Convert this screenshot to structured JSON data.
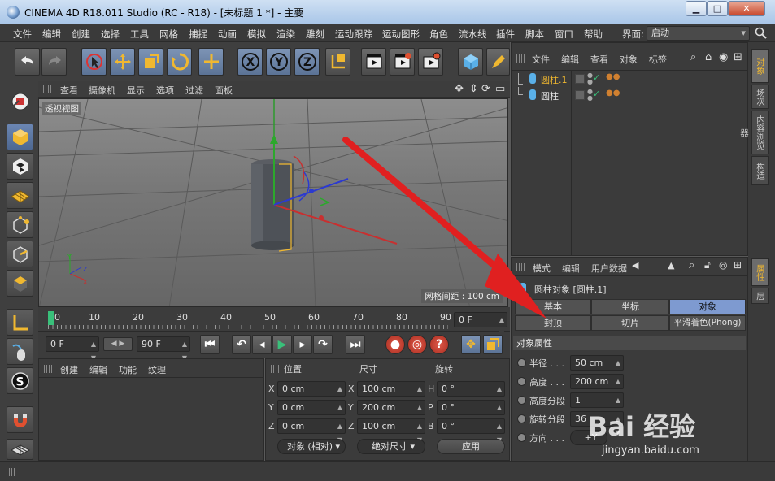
{
  "window": {
    "title": "CINEMA 4D R18.011 Studio (RC - R18) - [未标题 1 *] - 主要",
    "min": "▁",
    "max": "□",
    "close": "✕"
  },
  "menu": [
    "文件",
    "编辑",
    "创建",
    "选择",
    "工具",
    "网格",
    "捕捉",
    "动画",
    "模拟",
    "渲染",
    "雕刻",
    "运动跟踪",
    "运动图形",
    "角色",
    "流水线",
    "插件",
    "脚本",
    "窗口",
    "帮助"
  ],
  "layout": {
    "label": "界面:",
    "value": "启动"
  },
  "viewport": {
    "menu": [
      "查看",
      "摄像机",
      "显示",
      "选项",
      "过滤",
      "面板"
    ],
    "label": "透视视图",
    "grid": "网格间距 : 100 cm"
  },
  "timeline": {
    "ticks": [
      "0",
      "10",
      "20",
      "30",
      "40",
      "50",
      "60",
      "70",
      "80",
      "90"
    ],
    "frame": "0 F",
    "start": "0 F",
    "end": "90 F"
  },
  "material": {
    "menu": [
      "创建",
      "编辑",
      "功能",
      "纹理"
    ]
  },
  "coords": {
    "headers": {
      "pos": "位置",
      "size": "尺寸",
      "rot": "旋转"
    },
    "rows": [
      {
        "axis": "X",
        "pos": "0 cm",
        "saxis": "X",
        "size": "100 cm",
        "raxis": "H",
        "rot": "0 °"
      },
      {
        "axis": "Y",
        "pos": "0 cm",
        "saxis": "Y",
        "size": "200 cm",
        "raxis": "P",
        "rot": "0 °"
      },
      {
        "axis": "Z",
        "pos": "0 cm",
        "saxis": "Z",
        "size": "100 cm",
        "raxis": "B",
        "rot": "0 °"
      }
    ],
    "mode": "对象 (相对)",
    "sizemode": "绝对尺寸",
    "apply": "应用"
  },
  "objects": {
    "menu": [
      "文件",
      "编辑",
      "查看",
      "对象",
      "标签"
    ],
    "items": [
      {
        "name": "圆柱.1",
        "active": true
      },
      {
        "name": "圆柱",
        "active": false
      }
    ]
  },
  "right_tabs_top": [
    "对象",
    "场次",
    "内容浏览器",
    "构造"
  ],
  "right_tabs_bottom": [
    "属性",
    "层"
  ],
  "attributes": {
    "menu": [
      "模式",
      "编辑",
      "用户数据"
    ],
    "title": "圆柱对象 [圆柱.1]",
    "tabs_row1": [
      "基本",
      "坐标",
      "对象"
    ],
    "tabs_row2": [
      "封顶",
      "切片",
      "平滑着色(Phong)"
    ],
    "section": "对象属性",
    "props": [
      {
        "label": "半径 . . .",
        "value": "50 cm"
      },
      {
        "label": "高度 . . .",
        "value": "200 cm"
      },
      {
        "label": "高度分段",
        "value": "1"
      },
      {
        "label": "旋转分段",
        "value": "36"
      }
    ],
    "dir_label": "方向 . . .",
    "dir_value": "+Y"
  },
  "watermark": {
    "brand": "Bai 经验",
    "url": "jingyan.baidu.com"
  },
  "colors": {
    "accent": "#f0b830",
    "highlight": "#7e9ad0",
    "arrow": "#e02020"
  }
}
